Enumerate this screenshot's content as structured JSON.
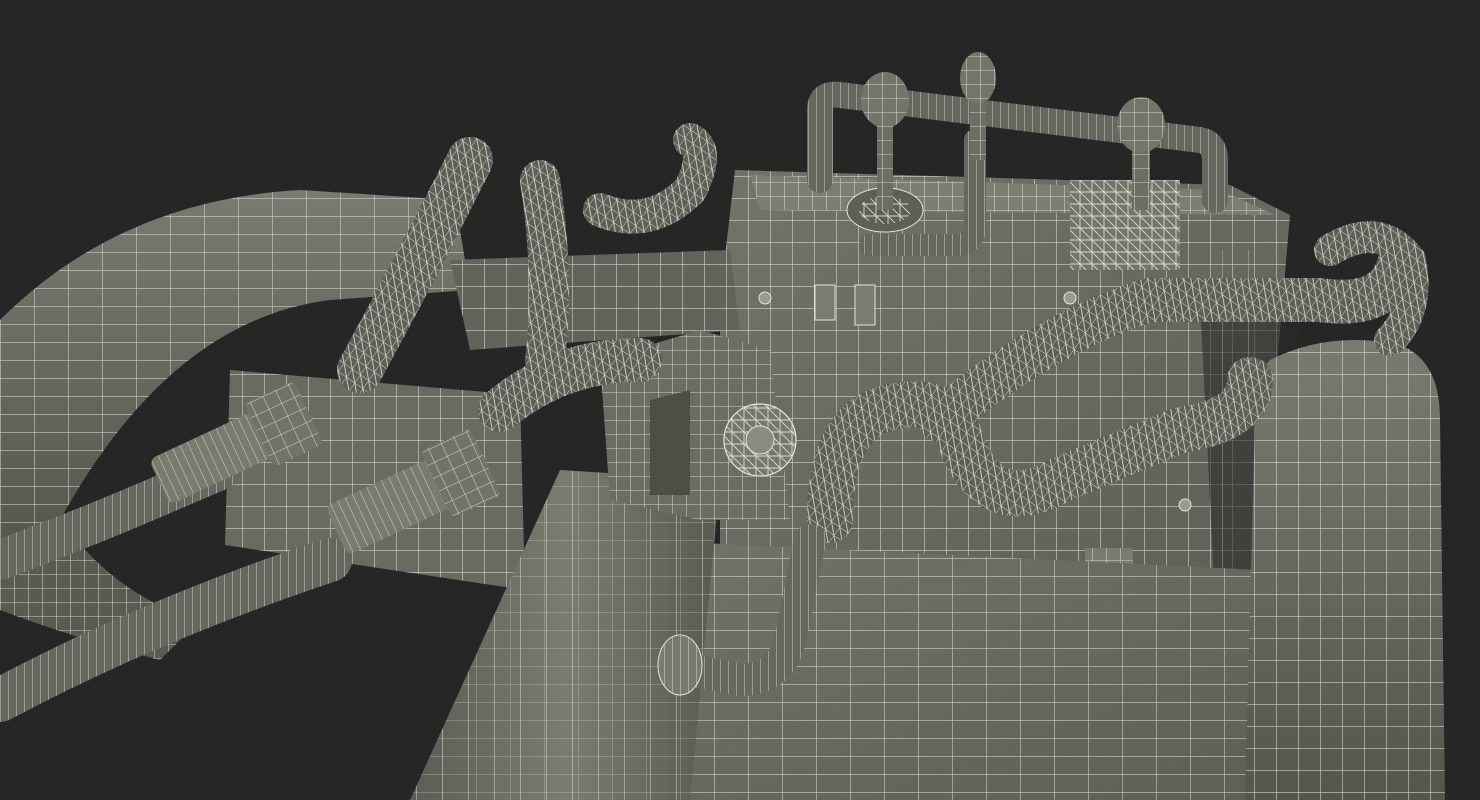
{
  "viewport": {
    "background": "#262626",
    "mesh_fill": "#6e6e64",
    "mesh_fill_dark": "#5a5a52",
    "mesh_fill_light": "#7c7c71",
    "wire_color": "#e4e4da",
    "shadow_color": "#1a1a1a"
  },
  "model": {
    "render_mode": "wireframe-on-shaded",
    "parts": [
      "left-fender",
      "right-fender",
      "boom-arm",
      "control-console",
      "joystick-levers",
      "grab-bar",
      "hydraulic-hoses",
      "hose-couplers",
      "front-plate",
      "pivot-bracket",
      "lift-cylinder",
      "floor-deck"
    ]
  }
}
